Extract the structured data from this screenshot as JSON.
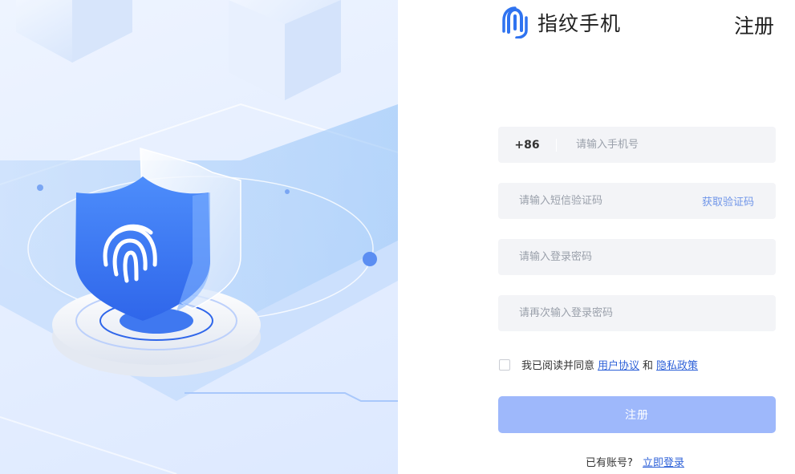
{
  "brand": {
    "name": "指纹手机",
    "logo_icon": "fingerprint-clip-logo",
    "accent": "#2f73f0"
  },
  "header": {
    "title": "注册"
  },
  "form": {
    "phone": {
      "prefix": "+86",
      "placeholder": "请输入手机号"
    },
    "sms_code": {
      "placeholder": "请输入短信验证码",
      "action": "获取验证码"
    },
    "password": {
      "placeholder": "请输入登录密码"
    },
    "confirm_password": {
      "placeholder": "请再次输入登录密码"
    },
    "agreement": {
      "text": "我已阅读并同意",
      "user_link": "用户协议",
      "and": "和",
      "privacy_link": "隐私政策",
      "checked": false
    },
    "submit_label": "注册"
  },
  "footer": {
    "prompt": "已有账号?",
    "login_link": "立即登录"
  },
  "hero": {
    "icon": "fingerprint-shield-icon"
  },
  "colors": {
    "button": "#9eb8fb",
    "link": "#2f62d8",
    "field_bg": "#f3f4f7"
  }
}
